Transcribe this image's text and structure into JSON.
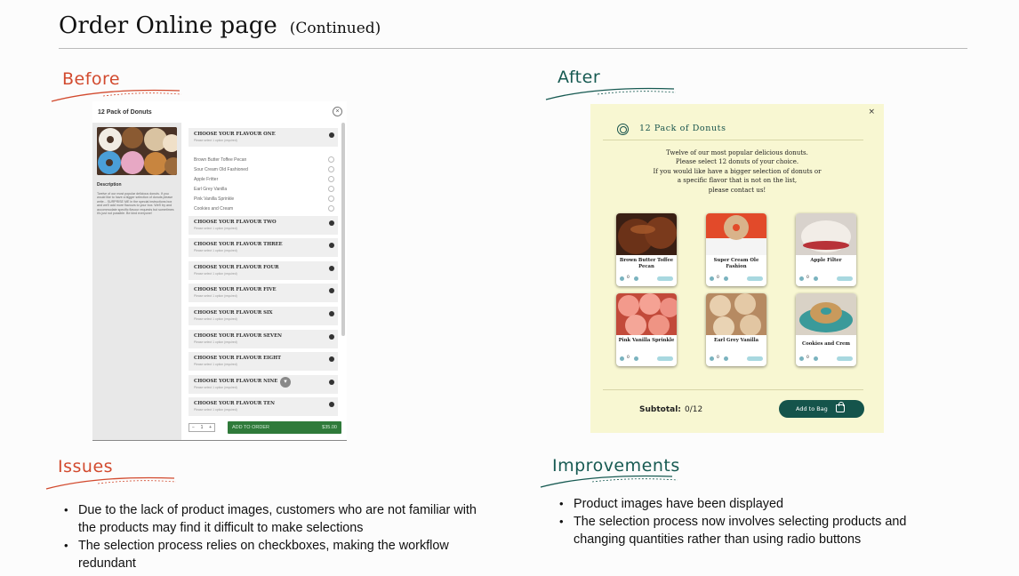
{
  "header": {
    "title": "Order Online page",
    "continued": "(Continued)"
  },
  "labels": {
    "before": "Before",
    "after": "After",
    "issues": "Issues",
    "improvements": "Improvements"
  },
  "before_panel": {
    "title": "12 Pack of Donuts",
    "close": "×",
    "description_heading": "Description",
    "description": "Twelve of our most popular delicious donuts. If you would like to have a bigger selection of donuts please write... SURPRISE ME in the special instructions box and we'll add more flavours to your box. We'll try and accommodate specific flavour requests but sometimes it's just not possible. Be kind everyone!",
    "flavour_sections": [
      {
        "title": "CHOOSE YOUR FLAVOUR ONE",
        "subtitle": "Please select 1 option (required)"
      },
      {
        "title": "CHOOSE YOUR FLAVOUR TWO",
        "subtitle": "Please select 1 option (required)"
      },
      {
        "title": "CHOOSE YOUR FLAVOUR THREE",
        "subtitle": "Please select 1 option (required)"
      },
      {
        "title": "CHOOSE YOUR FLAVOUR FOUR",
        "subtitle": "Please select 1 option (required)"
      },
      {
        "title": "CHOOSE YOUR FLAVOUR FIVE",
        "subtitle": "Please select 1 option (required)"
      },
      {
        "title": "CHOOSE YOUR FLAVOUR SIX",
        "subtitle": "Please select 1 option (required)"
      },
      {
        "title": "CHOOSE YOUR FLAVOUR SEVEN",
        "subtitle": "Please select 1 option (required)"
      },
      {
        "title": "CHOOSE YOUR FLAVOUR EIGHT",
        "subtitle": "Please select 1 option (required)"
      },
      {
        "title": "CHOOSE YOUR FLAVOUR NINE",
        "subtitle": "Please select 1 option (required)"
      },
      {
        "title": "CHOOSE YOUR FLAVOUR TEN",
        "subtitle": "Please select 1 option (required)"
      }
    ],
    "options": [
      "Brown Butter Toffee Pecan",
      "Sour Cream Old Fashioned",
      "Apple Fritter",
      "Earl Grey Vanilla",
      "Pink Vanilla Sprinkle",
      "Cookies and Cream"
    ],
    "stepper": {
      "minus": "−",
      "value": "1",
      "plus": "+"
    },
    "add_button": "ADD TO ORDER",
    "price": "$35.00"
  },
  "after_panel": {
    "title": "12 Pack of Donuts",
    "close": "×",
    "intro": [
      "Twelve of our most popular delicious donuts.",
      "Please select 12 donuts of your choice.",
      "If you would like  have a bigger selection of donuts or",
      "a specific flavor that is not on the list,",
      "please contact us!"
    ],
    "products": [
      {
        "name": "Brown Butter Toffee Pecan",
        "qty": "0"
      },
      {
        "name": "Super Cream Ole Fashion",
        "qty": "0"
      },
      {
        "name": "Apple Filter",
        "qty": "0"
      },
      {
        "name": "Pink Vanilla Sprinkle",
        "qty": "0"
      },
      {
        "name": "Earl Grey Vanilla",
        "qty": "0"
      },
      {
        "name": "Cookies and Crem",
        "qty": "0"
      }
    ],
    "subtotal_label": "Subtotal:",
    "subtotal_value": "0/12",
    "bag_button": "Add to Bag"
  },
  "issues": [
    "Due to the lack of product images, customers who are not familiar with the products may find it difficult to make selections",
    "The selection process relies on checkboxes, making the workflow redundant"
  ],
  "improvements": [
    "Product images have been displayed",
    "The selection process now involves selecting products and changing quantities rather than using radio buttons"
  ]
}
